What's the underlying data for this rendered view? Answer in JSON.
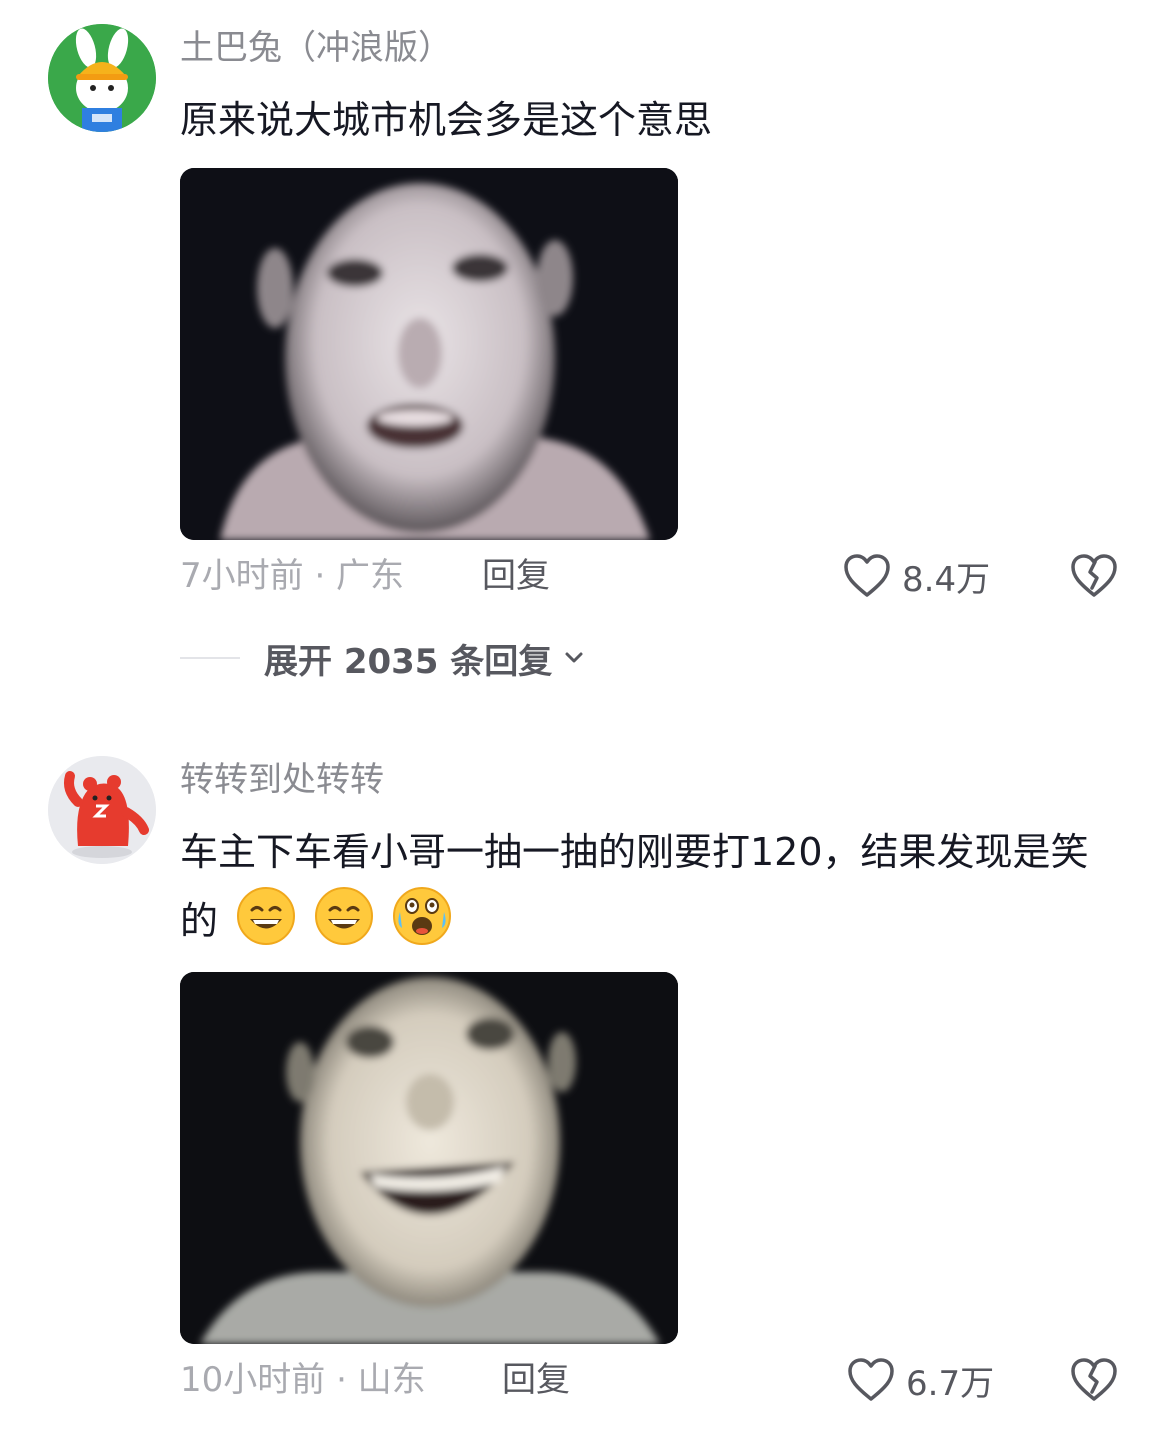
{
  "comments": [
    {
      "username": "土巴兔（冲浪版）",
      "text": "原来说大城市机会多是这个意思",
      "time_location": "7小时前 · 广东",
      "reply_label": "回复",
      "likes": "8.4万",
      "expand_label": "展开 2035 条回复",
      "avatar_icon": "rabbit-mascot-avatar",
      "avatar_color": "#3aa84a"
    },
    {
      "username": "转转到处转转",
      "text": "车主下车看小哥一抽一抽的刚要打120，结果发现是笑的",
      "emojis": [
        "grin-emoji",
        "grin-emoji",
        "laugh-cry-emoji"
      ],
      "time_location": "10小时前 · 山东",
      "reply_label": "回复",
      "likes": "6.7万",
      "avatar_icon": "red-bear-mascot-avatar",
      "avatar_color": "#e63b2e"
    }
  ]
}
